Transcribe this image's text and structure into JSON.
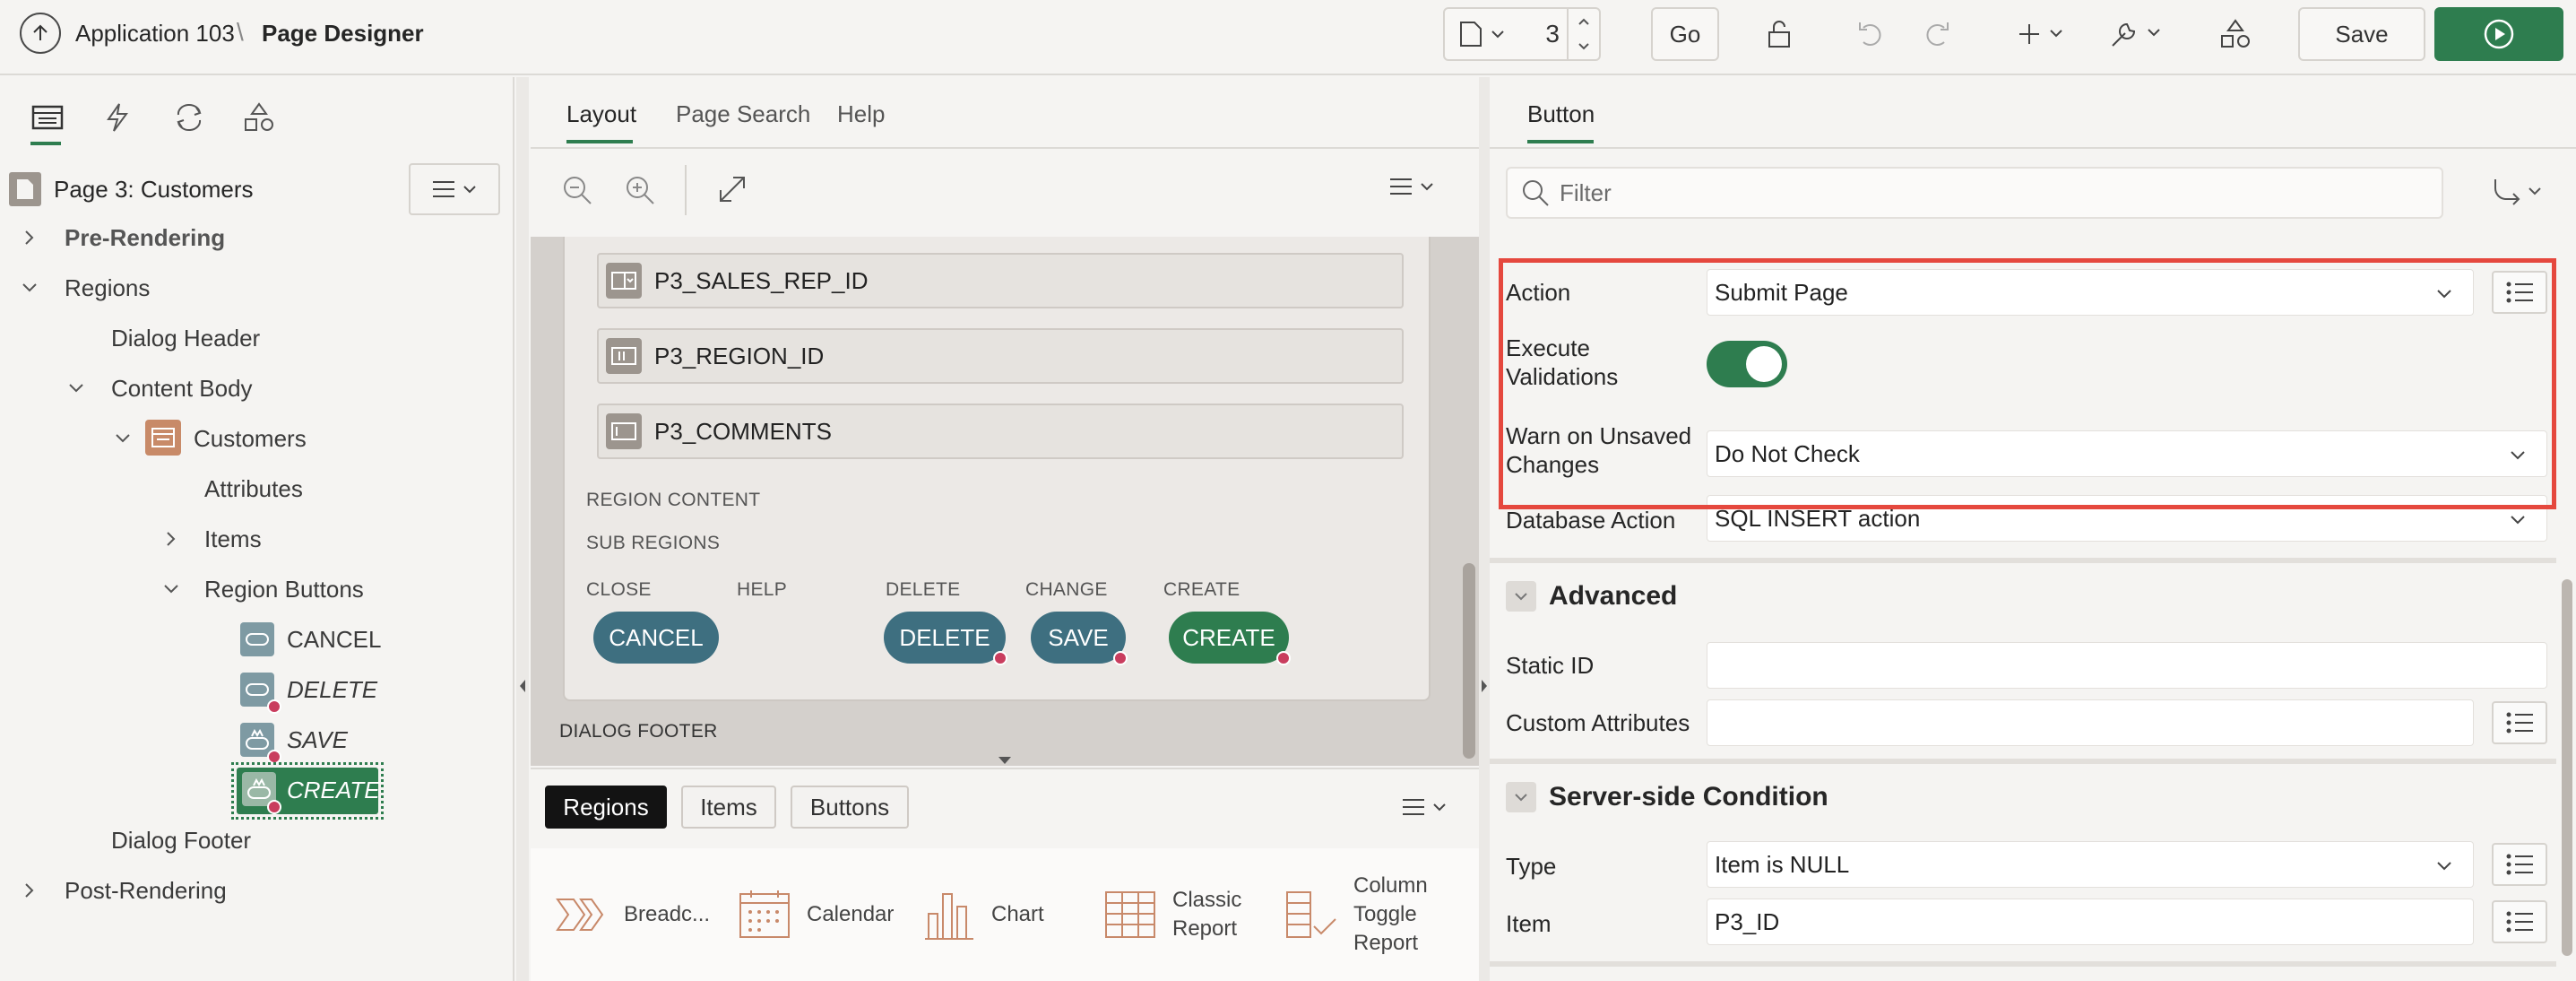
{
  "header": {
    "app_name": "Application 103",
    "separator": "\\",
    "page_designer": "Page Designer",
    "page_number": "3",
    "go_label": "Go",
    "save_label": "Save"
  },
  "left": {
    "page_title": "Page 3: Customers",
    "tree": {
      "pre_rendering": "Pre-Rendering",
      "regions": "Regions",
      "dialog_header": "Dialog Header",
      "content_body": "Content Body",
      "customers": "Customers",
      "attributes": "Attributes",
      "items": "Items",
      "region_buttons": "Region Buttons",
      "cancel": "CANCEL",
      "delete": "DELETE",
      "save": "SAVE",
      "create": "CREATE",
      "dialog_footer": "Dialog Footer",
      "post_rendering": "Post-Rendering"
    }
  },
  "center": {
    "tabs": {
      "layout": "Layout",
      "page_search": "Page Search",
      "help": "Help"
    },
    "fields": [
      "P3_SALES_REP_ID",
      "P3_REGION_ID",
      "P3_COMMENTS"
    ],
    "region_content": "REGION CONTENT",
    "sub_regions": "SUB REGIONS",
    "slots": {
      "close": "CLOSE",
      "help": "HELP",
      "delete": "DELETE",
      "change": "CHANGE",
      "create": "CREATE"
    },
    "buttons": {
      "cancel": "CANCEL",
      "delete": "DELETE",
      "save": "SAVE",
      "create": "CREATE"
    },
    "dialog_footer": "DIALOG FOOTER",
    "gallery_tabs": {
      "regions": "Regions",
      "items": "Items",
      "buttons": "Buttons"
    },
    "gallery_items": {
      "breadcrumb": "Breadc...",
      "calendar": "Calendar",
      "chart": "Chart",
      "classic_report_1": "Classic",
      "classic_report_2": "Report",
      "column_toggle_1": "Column",
      "column_toggle_2": "Toggle",
      "column_toggle_3": "Report"
    }
  },
  "right": {
    "tab": "Button",
    "filter_placeholder": "Filter",
    "action_label": "Action",
    "action_value": "Submit Page",
    "exec_val_1": "Execute",
    "exec_val_2": "Validations",
    "warn_1": "Warn on Unsaved",
    "warn_2": "Changes",
    "warn_value": "Do Not Check",
    "db_action_label": "Database Action",
    "db_action_value": "SQL INSERT action",
    "advanced": "Advanced",
    "static_id": "Static ID",
    "custom_attributes": "Custom Attributes",
    "server_side": "Server-side Condition",
    "type_label": "Type",
    "type_value": "Item is NULL",
    "item_label": "Item",
    "item_value": "P3_ID"
  },
  "colors": {
    "primary_green": "#2e7d4f",
    "teal_button": "#3e6f80",
    "highlight_red": "#e5483e",
    "error_dot": "#c93d5e"
  }
}
